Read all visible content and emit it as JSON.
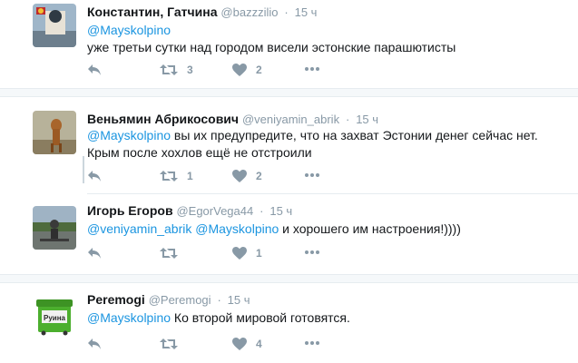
{
  "tweets": [
    {
      "name": "Константин, Гатчина",
      "handle": "@bazzzilio",
      "time": "15 ч",
      "mention": "@Mayskolpino",
      "text": "уже третьи сутки над городом висели эстонские парашютисты",
      "retweets": "3",
      "likes": "2"
    },
    {
      "name": "Веньямин Абрикосович",
      "handle": "@veniyamin_abrik",
      "time": "15 ч",
      "mention": "@Mayskolpino",
      "text_line1": " вы их предупредите, что на захват Эстонии денег сейчас нет.",
      "text_line2": "Крым после хохлов ещё не отстроили",
      "retweets": "1",
      "likes": "2"
    },
    {
      "name": "Игорь Егоров",
      "handle": "@EgorVega44",
      "time": "15 ч",
      "mention1": "@veniyamin_abrik",
      "mention2": "@Mayskolpino",
      "text": " и хорошего им настроения!))))",
      "likes": "1"
    },
    {
      "name": "Peremogi",
      "handle": "@Peremogi",
      "time": "15 ч",
      "mention": "@Mayskolpino",
      "text": " Ко второй мировой готовятся.",
      "likes": "4",
      "avatar_label": "Руина"
    }
  ],
  "icons": {
    "reply": "reply-icon",
    "retweet": "retweet-icon",
    "like": "heart-icon",
    "more": "more-icon"
  },
  "colors": {
    "mention": "#1b95e0",
    "muted": "#8899a6",
    "divider_bg": "#f5f8fa"
  }
}
